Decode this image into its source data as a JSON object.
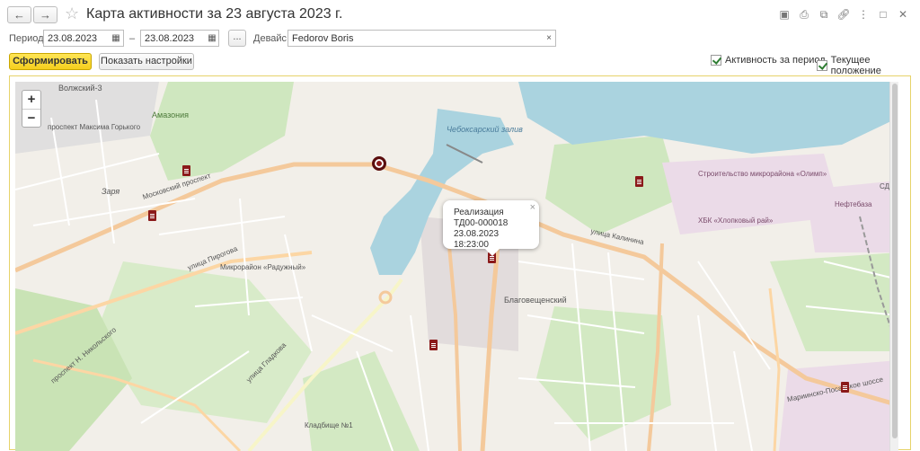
{
  "window": {
    "title": "Карта активности за 23 августа 2023 г.",
    "back_icon": "arrow-left-icon",
    "forward_icon": "arrow-right-icon",
    "toolbar_icons": [
      "save-icon",
      "print-icon",
      "copy-icon",
      "link-icon",
      "more-icon",
      "maximize-icon",
      "close-icon"
    ]
  },
  "filters": {
    "period_label": "Период:",
    "date_from": "23.08.2023",
    "dash": "–",
    "date_to": "23.08.2023",
    "more_label": "...",
    "device_label": "Девайс:",
    "device_value": "Fedorov Boris",
    "clear_label": "×"
  },
  "actions": {
    "generate_label": "Сформировать",
    "settings_label": "Показать настройки",
    "activity_checkbox": "Активность за период",
    "current_position_checkbox": "Текущее положение"
  },
  "map": {
    "zoom_in": "+",
    "zoom_out": "−",
    "popup": {
      "line1": "Реализация",
      "line2": "ТД00-000018",
      "line3": "23.08.2023 18:23:00",
      "close": "×"
    },
    "labels": {
      "volzhsky": "Волжский-3",
      "amazonia": "Амазония",
      "prospect_gorkogo": "проспект Максима Горького",
      "moskovsky": "Московский проспект",
      "zarya": "Заря",
      "pirogova": "улица Пирогова",
      "raduzhny": "Микрорайон «Радужный»",
      "cheboksary_bay": "Чебоксарский залив",
      "blagoveshchensky": "Благовещенский",
      "kalinina": "улица Калинина",
      "hbk": "ХБК «Хлопковый рай»",
      "olymp": "Строительство микрорайона «Олимп»",
      "neftebaza": "Нефтебаза",
      "marposad": "Мариинско-Посадское шоссе",
      "kladbishche": "Кладбище №1",
      "nikolsky": "проспект Н. Никольского",
      "traktorostr": "улица Гладкова",
      "sdt": "СДТ"
    }
  }
}
